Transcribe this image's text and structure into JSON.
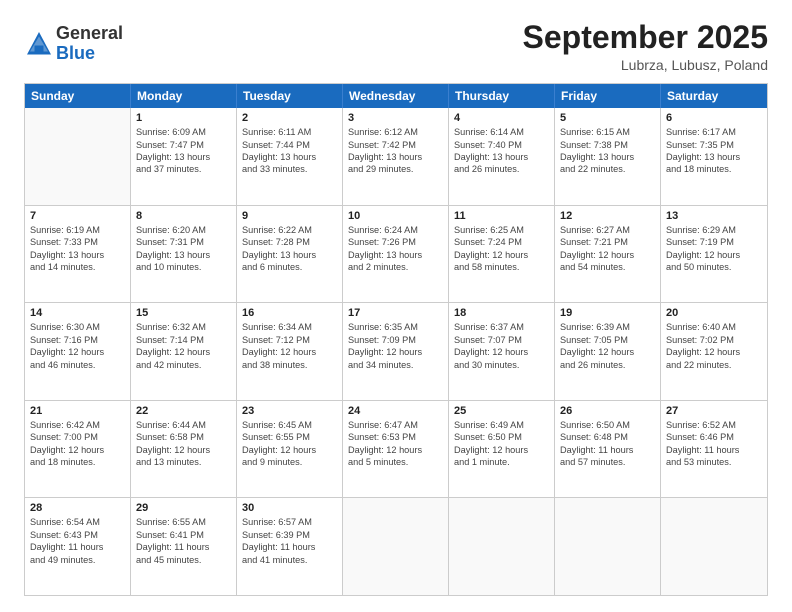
{
  "header": {
    "logo": {
      "general": "General",
      "blue": "Blue"
    },
    "title": "September 2025",
    "location": "Lubrza, Lubusz, Poland"
  },
  "calendar": {
    "weekdays": [
      "Sunday",
      "Monday",
      "Tuesday",
      "Wednesday",
      "Thursday",
      "Friday",
      "Saturday"
    ],
    "rows": [
      [
        {
          "day": "",
          "empty": true
        },
        {
          "day": "1",
          "line1": "Sunrise: 6:09 AM",
          "line2": "Sunset: 7:47 PM",
          "line3": "Daylight: 13 hours",
          "line4": "and 37 minutes."
        },
        {
          "day": "2",
          "line1": "Sunrise: 6:11 AM",
          "line2": "Sunset: 7:44 PM",
          "line3": "Daylight: 13 hours",
          "line4": "and 33 minutes."
        },
        {
          "day": "3",
          "line1": "Sunrise: 6:12 AM",
          "line2": "Sunset: 7:42 PM",
          "line3": "Daylight: 13 hours",
          "line4": "and 29 minutes."
        },
        {
          "day": "4",
          "line1": "Sunrise: 6:14 AM",
          "line2": "Sunset: 7:40 PM",
          "line3": "Daylight: 13 hours",
          "line4": "and 26 minutes."
        },
        {
          "day": "5",
          "line1": "Sunrise: 6:15 AM",
          "line2": "Sunset: 7:38 PM",
          "line3": "Daylight: 13 hours",
          "line4": "and 22 minutes."
        },
        {
          "day": "6",
          "line1": "Sunrise: 6:17 AM",
          "line2": "Sunset: 7:35 PM",
          "line3": "Daylight: 13 hours",
          "line4": "and 18 minutes."
        }
      ],
      [
        {
          "day": "7",
          "line1": "Sunrise: 6:19 AM",
          "line2": "Sunset: 7:33 PM",
          "line3": "Daylight: 13 hours",
          "line4": "and 14 minutes."
        },
        {
          "day": "8",
          "line1": "Sunrise: 6:20 AM",
          "line2": "Sunset: 7:31 PM",
          "line3": "Daylight: 13 hours",
          "line4": "and 10 minutes."
        },
        {
          "day": "9",
          "line1": "Sunrise: 6:22 AM",
          "line2": "Sunset: 7:28 PM",
          "line3": "Daylight: 13 hours",
          "line4": "and 6 minutes."
        },
        {
          "day": "10",
          "line1": "Sunrise: 6:24 AM",
          "line2": "Sunset: 7:26 PM",
          "line3": "Daylight: 13 hours",
          "line4": "and 2 minutes."
        },
        {
          "day": "11",
          "line1": "Sunrise: 6:25 AM",
          "line2": "Sunset: 7:24 PM",
          "line3": "Daylight: 12 hours",
          "line4": "and 58 minutes."
        },
        {
          "day": "12",
          "line1": "Sunrise: 6:27 AM",
          "line2": "Sunset: 7:21 PM",
          "line3": "Daylight: 12 hours",
          "line4": "and 54 minutes."
        },
        {
          "day": "13",
          "line1": "Sunrise: 6:29 AM",
          "line2": "Sunset: 7:19 PM",
          "line3": "Daylight: 12 hours",
          "line4": "and 50 minutes."
        }
      ],
      [
        {
          "day": "14",
          "line1": "Sunrise: 6:30 AM",
          "line2": "Sunset: 7:16 PM",
          "line3": "Daylight: 12 hours",
          "line4": "and 46 minutes."
        },
        {
          "day": "15",
          "line1": "Sunrise: 6:32 AM",
          "line2": "Sunset: 7:14 PM",
          "line3": "Daylight: 12 hours",
          "line4": "and 42 minutes."
        },
        {
          "day": "16",
          "line1": "Sunrise: 6:34 AM",
          "line2": "Sunset: 7:12 PM",
          "line3": "Daylight: 12 hours",
          "line4": "and 38 minutes."
        },
        {
          "day": "17",
          "line1": "Sunrise: 6:35 AM",
          "line2": "Sunset: 7:09 PM",
          "line3": "Daylight: 12 hours",
          "line4": "and 34 minutes."
        },
        {
          "day": "18",
          "line1": "Sunrise: 6:37 AM",
          "line2": "Sunset: 7:07 PM",
          "line3": "Daylight: 12 hours",
          "line4": "and 30 minutes."
        },
        {
          "day": "19",
          "line1": "Sunrise: 6:39 AM",
          "line2": "Sunset: 7:05 PM",
          "line3": "Daylight: 12 hours",
          "line4": "and 26 minutes."
        },
        {
          "day": "20",
          "line1": "Sunrise: 6:40 AM",
          "line2": "Sunset: 7:02 PM",
          "line3": "Daylight: 12 hours",
          "line4": "and 22 minutes."
        }
      ],
      [
        {
          "day": "21",
          "line1": "Sunrise: 6:42 AM",
          "line2": "Sunset: 7:00 PM",
          "line3": "Daylight: 12 hours",
          "line4": "and 18 minutes."
        },
        {
          "day": "22",
          "line1": "Sunrise: 6:44 AM",
          "line2": "Sunset: 6:58 PM",
          "line3": "Daylight: 12 hours",
          "line4": "and 13 minutes."
        },
        {
          "day": "23",
          "line1": "Sunrise: 6:45 AM",
          "line2": "Sunset: 6:55 PM",
          "line3": "Daylight: 12 hours",
          "line4": "and 9 minutes."
        },
        {
          "day": "24",
          "line1": "Sunrise: 6:47 AM",
          "line2": "Sunset: 6:53 PM",
          "line3": "Daylight: 12 hours",
          "line4": "and 5 minutes."
        },
        {
          "day": "25",
          "line1": "Sunrise: 6:49 AM",
          "line2": "Sunset: 6:50 PM",
          "line3": "Daylight: 12 hours",
          "line4": "and 1 minute."
        },
        {
          "day": "26",
          "line1": "Sunrise: 6:50 AM",
          "line2": "Sunset: 6:48 PM",
          "line3": "Daylight: 11 hours",
          "line4": "and 57 minutes."
        },
        {
          "day": "27",
          "line1": "Sunrise: 6:52 AM",
          "line2": "Sunset: 6:46 PM",
          "line3": "Daylight: 11 hours",
          "line4": "and 53 minutes."
        }
      ],
      [
        {
          "day": "28",
          "line1": "Sunrise: 6:54 AM",
          "line2": "Sunset: 6:43 PM",
          "line3": "Daylight: 11 hours",
          "line4": "and 49 minutes."
        },
        {
          "day": "29",
          "line1": "Sunrise: 6:55 AM",
          "line2": "Sunset: 6:41 PM",
          "line3": "Daylight: 11 hours",
          "line4": "and 45 minutes."
        },
        {
          "day": "30",
          "line1": "Sunrise: 6:57 AM",
          "line2": "Sunset: 6:39 PM",
          "line3": "Daylight: 11 hours",
          "line4": "and 41 minutes."
        },
        {
          "day": "",
          "empty": true
        },
        {
          "day": "",
          "empty": true
        },
        {
          "day": "",
          "empty": true
        },
        {
          "day": "",
          "empty": true
        }
      ]
    ]
  }
}
